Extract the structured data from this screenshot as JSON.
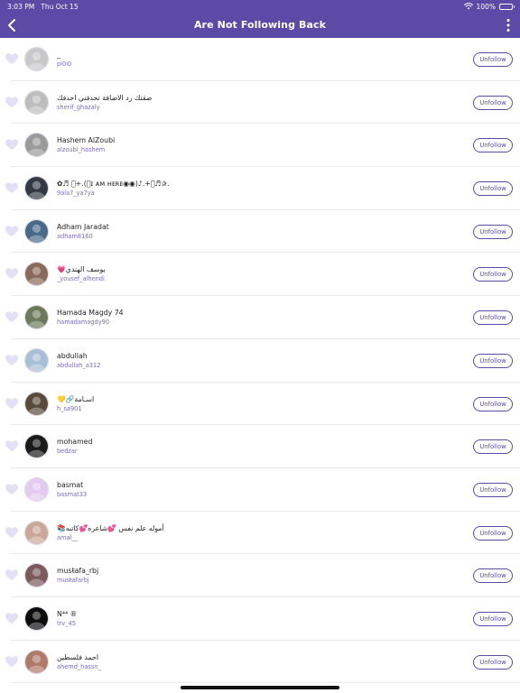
{
  "status_bar": {
    "time": "3:03 PM",
    "date": "Thu Oct 15",
    "battery": "100%"
  },
  "header": {
    "title": "Are Not Following Back",
    "back_icon": "chevron-left-icon",
    "menu_icon": "more-vertical-icon"
  },
  "colors": {
    "accent": "#5b4aa6",
    "handle": "#7a6bc0",
    "heart": "#e3dff5"
  },
  "button_label": "Unfollow",
  "users": [
    {
      "name": "_",
      "handle": "pi0i0",
      "avatar": "#c8c8c8"
    },
    {
      "name": "ضقتك رد الاضافة تحذفني احذفك",
      "handle": "sherif_ghazaly",
      "avatar": "#bdbdbd"
    },
    {
      "name": "Hashem AlZoubi",
      "handle": "alzoubi_hashem",
      "avatar": "#9a9a9a"
    },
    {
      "name": "✿♬ ﾟ+.(｡ɪ ᴀᴍ ʜᴇʀᴇ◉◉)♪.+ﾟ♬✰.",
      "handle": "9ala7_ya7ya",
      "avatar": "#333a44"
    },
    {
      "name": "Adham Jaradat",
      "handle": "adham8160",
      "avatar": "#4a6a8a"
    },
    {
      "name": "💗يوسف الهندي",
      "handle": "_yousef_alhendi",
      "avatar": "#8a6a5a"
    },
    {
      "name": "Hamada Magdy 74",
      "handle": "hamadamagdy90",
      "avatar": "#6a7a5a"
    },
    {
      "name": "abdullah",
      "handle": "abdullah_a312",
      "avatar": "#a9bfd6"
    },
    {
      "name": "💛🔗اسـامة",
      "handle": "h_sa901",
      "avatar": "#5a4a3a"
    },
    {
      "name": "mohamed",
      "handle": "bedzar",
      "avatar": "#1a1a1a"
    },
    {
      "name": "basmat",
      "handle": "basmat33",
      "avatar": "#e4c9f0"
    },
    {
      "name": "📚أموله علم نفس 💕شاعره💕كاتبه",
      "handle": "amal__",
      "avatar": "#c9a89a"
    },
    {
      "name": "musŧafa_rbj",
      "handle": "musŧafarbj",
      "avatar": "#7a5a5a"
    },
    {
      "name": "N⁴⁴ ®",
      "handle": "trv_45",
      "avatar": "#0d0d0d"
    },
    {
      "name": "احمد فلسطين",
      "handle": "ahemd_hassn_",
      "avatar": "#b07a6a"
    }
  ]
}
